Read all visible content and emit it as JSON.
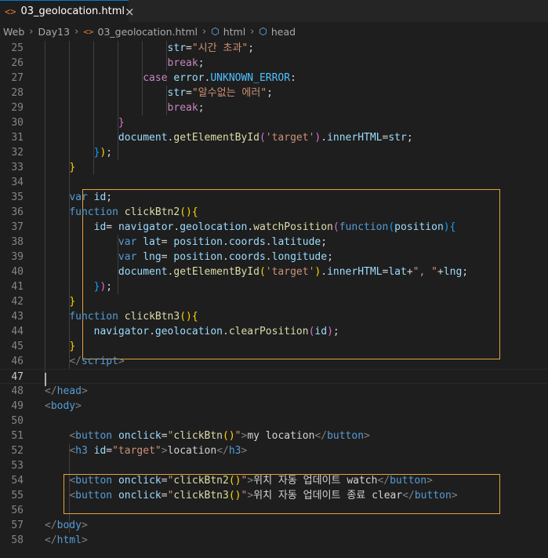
{
  "tab": {
    "icon": "<>",
    "filename": "03_geolocation.html",
    "close": "×"
  },
  "breadcrumb": {
    "items": [
      "Web",
      "Day13",
      "03_geolocation.html",
      "html",
      "head"
    ]
  },
  "lines": [
    {
      "n": "25",
      "segs": [
        {
          "t": "                    ",
          "c": "txt"
        },
        {
          "t": "str",
          "c": "var"
        },
        {
          "t": "=",
          "c": "txt"
        },
        {
          "t": "\"시간 초과\"",
          "c": "str"
        },
        {
          "t": ";",
          "c": "txt"
        }
      ]
    },
    {
      "n": "26",
      "segs": [
        {
          "t": "                    ",
          "c": "txt"
        },
        {
          "t": "break",
          "c": "ctl"
        },
        {
          "t": ";",
          "c": "txt"
        }
      ]
    },
    {
      "n": "27",
      "segs": [
        {
          "t": "                ",
          "c": "txt"
        },
        {
          "t": "case",
          "c": "ctl"
        },
        {
          "t": " ",
          "c": "txt"
        },
        {
          "t": "error",
          "c": "var"
        },
        {
          "t": ".",
          "c": "txt"
        },
        {
          "t": "UNKNOWN_ERROR",
          "c": "cst"
        },
        {
          "t": ":",
          "c": "txt"
        }
      ]
    },
    {
      "n": "28",
      "segs": [
        {
          "t": "                    ",
          "c": "txt"
        },
        {
          "t": "str",
          "c": "var"
        },
        {
          "t": "=",
          "c": "txt"
        },
        {
          "t": "\"알수없는 에러\"",
          "c": "str"
        },
        {
          "t": ";",
          "c": "txt"
        }
      ]
    },
    {
      "n": "29",
      "segs": [
        {
          "t": "                    ",
          "c": "txt"
        },
        {
          "t": "break",
          "c": "ctl"
        },
        {
          "t": ";",
          "c": "txt"
        }
      ]
    },
    {
      "n": "30",
      "segs": [
        {
          "t": "            ",
          "c": "txt"
        },
        {
          "t": "}",
          "c": "paren"
        }
      ]
    },
    {
      "n": "31",
      "segs": [
        {
          "t": "            ",
          "c": "txt"
        },
        {
          "t": "document",
          "c": "var"
        },
        {
          "t": ".",
          "c": "txt"
        },
        {
          "t": "getElementById",
          "c": "fn"
        },
        {
          "t": "(",
          "c": "paren"
        },
        {
          "t": "'target'",
          "c": "str"
        },
        {
          "t": ")",
          "c": "paren"
        },
        {
          "t": ".",
          "c": "txt"
        },
        {
          "t": "innerHTML",
          "c": "var"
        },
        {
          "t": "=",
          "c": "txt"
        },
        {
          "t": "str",
          "c": "var"
        },
        {
          "t": ";",
          "c": "txt"
        }
      ]
    },
    {
      "n": "32",
      "segs": [
        {
          "t": "        ",
          "c": "txt"
        },
        {
          "t": "}",
          "c": "paren2"
        },
        {
          "t": ")",
          "c": "paren3"
        },
        {
          "t": ";",
          "c": "txt"
        }
      ]
    },
    {
      "n": "33",
      "segs": [
        {
          "t": "    ",
          "c": "txt"
        },
        {
          "t": "}",
          "c": "paren3"
        }
      ]
    },
    {
      "n": "34",
      "segs": []
    },
    {
      "n": "35",
      "segs": [
        {
          "t": "    ",
          "c": "txt"
        },
        {
          "t": "var",
          "c": "kw"
        },
        {
          "t": " ",
          "c": "txt"
        },
        {
          "t": "id",
          "c": "var"
        },
        {
          "t": ";",
          "c": "txt"
        }
      ]
    },
    {
      "n": "36",
      "segs": [
        {
          "t": "    ",
          "c": "txt"
        },
        {
          "t": "function",
          "c": "kw"
        },
        {
          "t": " ",
          "c": "txt"
        },
        {
          "t": "clickBtn2",
          "c": "fn"
        },
        {
          "t": "()",
          "c": "paren3"
        },
        {
          "t": "{",
          "c": "paren3"
        }
      ]
    },
    {
      "n": "37",
      "segs": [
        {
          "t": "        ",
          "c": "txt"
        },
        {
          "t": "id",
          "c": "var"
        },
        {
          "t": "= ",
          "c": "txt"
        },
        {
          "t": "navigator",
          "c": "var"
        },
        {
          "t": ".",
          "c": "txt"
        },
        {
          "t": "geolocation",
          "c": "var"
        },
        {
          "t": ".",
          "c": "txt"
        },
        {
          "t": "watchPosition",
          "c": "fn"
        },
        {
          "t": "(",
          "c": "paren"
        },
        {
          "t": "function",
          "c": "kw"
        },
        {
          "t": "(",
          "c": "paren2"
        },
        {
          "t": "position",
          "c": "var"
        },
        {
          "t": ")",
          "c": "paren2"
        },
        {
          "t": "{",
          "c": "paren2"
        }
      ]
    },
    {
      "n": "38",
      "segs": [
        {
          "t": "            ",
          "c": "txt"
        },
        {
          "t": "var",
          "c": "kw"
        },
        {
          "t": " ",
          "c": "txt"
        },
        {
          "t": "lat",
          "c": "var"
        },
        {
          "t": "= ",
          "c": "txt"
        },
        {
          "t": "position",
          "c": "var"
        },
        {
          "t": ".",
          "c": "txt"
        },
        {
          "t": "coords",
          "c": "var"
        },
        {
          "t": ".",
          "c": "txt"
        },
        {
          "t": "latitude",
          "c": "var"
        },
        {
          "t": ";",
          "c": "txt"
        }
      ]
    },
    {
      "n": "39",
      "segs": [
        {
          "t": "            ",
          "c": "txt"
        },
        {
          "t": "var",
          "c": "kw"
        },
        {
          "t": " ",
          "c": "txt"
        },
        {
          "t": "lng",
          "c": "var"
        },
        {
          "t": "= ",
          "c": "txt"
        },
        {
          "t": "position",
          "c": "var"
        },
        {
          "t": ".",
          "c": "txt"
        },
        {
          "t": "coords",
          "c": "var"
        },
        {
          "t": ".",
          "c": "txt"
        },
        {
          "t": "longitude",
          "c": "var"
        },
        {
          "t": ";",
          "c": "txt"
        }
      ]
    },
    {
      "n": "40",
      "segs": [
        {
          "t": "            ",
          "c": "txt"
        },
        {
          "t": "document",
          "c": "var"
        },
        {
          "t": ".",
          "c": "txt"
        },
        {
          "t": "getElementById",
          "c": "fn"
        },
        {
          "t": "(",
          "c": "paren3"
        },
        {
          "t": "'target'",
          "c": "str"
        },
        {
          "t": ")",
          "c": "paren3"
        },
        {
          "t": ".",
          "c": "txt"
        },
        {
          "t": "innerHTML",
          "c": "var"
        },
        {
          "t": "=",
          "c": "txt"
        },
        {
          "t": "lat",
          "c": "var"
        },
        {
          "t": "+",
          "c": "txt"
        },
        {
          "t": "\", \"",
          "c": "str"
        },
        {
          "t": "+",
          "c": "txt"
        },
        {
          "t": "lng",
          "c": "var"
        },
        {
          "t": ";",
          "c": "txt"
        }
      ]
    },
    {
      "n": "41",
      "segs": [
        {
          "t": "        ",
          "c": "txt"
        },
        {
          "t": "}",
          "c": "paren2"
        },
        {
          "t": ")",
          "c": "paren"
        },
        {
          "t": ";",
          "c": "txt"
        }
      ]
    },
    {
      "n": "42",
      "segs": [
        {
          "t": "    ",
          "c": "txt"
        },
        {
          "t": "}",
          "c": "paren3"
        }
      ]
    },
    {
      "n": "43",
      "segs": [
        {
          "t": "    ",
          "c": "txt"
        },
        {
          "t": "function",
          "c": "kw"
        },
        {
          "t": " ",
          "c": "txt"
        },
        {
          "t": "clickBtn3",
          "c": "fn"
        },
        {
          "t": "()",
          "c": "paren3"
        },
        {
          "t": "{",
          "c": "paren3"
        }
      ]
    },
    {
      "n": "44",
      "segs": [
        {
          "t": "        ",
          "c": "txt"
        },
        {
          "t": "navigator",
          "c": "var"
        },
        {
          "t": ".",
          "c": "txt"
        },
        {
          "t": "geolocation",
          "c": "var"
        },
        {
          "t": ".",
          "c": "txt"
        },
        {
          "t": "clearPosition",
          "c": "fn"
        },
        {
          "t": "(",
          "c": "paren"
        },
        {
          "t": "id",
          "c": "var"
        },
        {
          "t": ")",
          "c": "paren"
        },
        {
          "t": ";",
          "c": "txt"
        }
      ]
    },
    {
      "n": "45",
      "segs": [
        {
          "t": "    ",
          "c": "txt"
        },
        {
          "t": "}",
          "c": "paren3"
        }
      ]
    },
    {
      "n": "46",
      "segs": [
        {
          "t": "    ",
          "c": "txt"
        },
        {
          "t": "</",
          "c": "br"
        },
        {
          "t": "script",
          "c": "tag"
        },
        {
          "t": ">",
          "c": "br"
        }
      ]
    },
    {
      "n": "47",
      "segs": []
    },
    {
      "n": "48",
      "segs": [
        {
          "t": "</",
          "c": "br"
        },
        {
          "t": "head",
          "c": "tag"
        },
        {
          "t": ">",
          "c": "br"
        }
      ]
    },
    {
      "n": "49",
      "segs": [
        {
          "t": "<",
          "c": "br"
        },
        {
          "t": "body",
          "c": "tag"
        },
        {
          "t": ">",
          "c": "br"
        }
      ]
    },
    {
      "n": "50",
      "segs": []
    },
    {
      "n": "51",
      "segs": [
        {
          "t": "    ",
          "c": "txt"
        },
        {
          "t": "<",
          "c": "br"
        },
        {
          "t": "button",
          "c": "tag"
        },
        {
          "t": " ",
          "c": "txt"
        },
        {
          "t": "onclick",
          "c": "attr"
        },
        {
          "t": "=",
          "c": "txt"
        },
        {
          "t": "\"",
          "c": "str"
        },
        {
          "t": "clickBtn",
          "c": "fn"
        },
        {
          "t": "()",
          "c": "paren3"
        },
        {
          "t": "\"",
          "c": "str"
        },
        {
          "t": ">",
          "c": "br"
        },
        {
          "t": "my location",
          "c": "txt"
        },
        {
          "t": "</",
          "c": "br"
        },
        {
          "t": "button",
          "c": "tag"
        },
        {
          "t": ">",
          "c": "br"
        }
      ]
    },
    {
      "n": "52",
      "segs": [
        {
          "t": "    ",
          "c": "txt"
        },
        {
          "t": "<",
          "c": "br"
        },
        {
          "t": "h3",
          "c": "tag"
        },
        {
          "t": " ",
          "c": "txt"
        },
        {
          "t": "id",
          "c": "attr"
        },
        {
          "t": "=",
          "c": "txt"
        },
        {
          "t": "\"target\"",
          "c": "str"
        },
        {
          "t": ">",
          "c": "br"
        },
        {
          "t": "location",
          "c": "txt"
        },
        {
          "t": "</",
          "c": "br"
        },
        {
          "t": "h3",
          "c": "tag"
        },
        {
          "t": ">",
          "c": "br"
        }
      ]
    },
    {
      "n": "53",
      "segs": []
    },
    {
      "n": "54",
      "segs": [
        {
          "t": "    ",
          "c": "txt"
        },
        {
          "t": "<",
          "c": "br"
        },
        {
          "t": "button",
          "c": "tag"
        },
        {
          "t": " ",
          "c": "txt"
        },
        {
          "t": "onclick",
          "c": "attr"
        },
        {
          "t": "=",
          "c": "txt"
        },
        {
          "t": "\"",
          "c": "str"
        },
        {
          "t": "clickBtn2",
          "c": "fn"
        },
        {
          "t": "()",
          "c": "paren3"
        },
        {
          "t": "\"",
          "c": "str"
        },
        {
          "t": ">",
          "c": "br"
        },
        {
          "t": "위치 자동 업데이트 watch",
          "c": "txt"
        },
        {
          "t": "</",
          "c": "br"
        },
        {
          "t": "button",
          "c": "tag"
        },
        {
          "t": ">",
          "c": "br"
        }
      ]
    },
    {
      "n": "55",
      "segs": [
        {
          "t": "    ",
          "c": "txt"
        },
        {
          "t": "<",
          "c": "br"
        },
        {
          "t": "button",
          "c": "tag"
        },
        {
          "t": " ",
          "c": "txt"
        },
        {
          "t": "onclick",
          "c": "attr"
        },
        {
          "t": "=",
          "c": "txt"
        },
        {
          "t": "\"",
          "c": "str"
        },
        {
          "t": "clickBtn3",
          "c": "fn"
        },
        {
          "t": "()",
          "c": "paren3"
        },
        {
          "t": "\"",
          "c": "str"
        },
        {
          "t": ">",
          "c": "br"
        },
        {
          "t": "위치 자동 업데이트 종료 clear",
          "c": "txt"
        },
        {
          "t": "</",
          "c": "br"
        },
        {
          "t": "button",
          "c": "tag"
        },
        {
          "t": ">",
          "c": "br"
        }
      ]
    },
    {
      "n": "56",
      "segs": []
    },
    {
      "n": "57",
      "segs": [
        {
          "t": "</",
          "c": "br"
        },
        {
          "t": "body",
          "c": "tag"
        },
        {
          "t": ">",
          "c": "br"
        }
      ]
    },
    {
      "n": "58",
      "segs": [
        {
          "t": "</",
          "c": "br"
        },
        {
          "t": "html",
          "c": "tag"
        },
        {
          "t": ">",
          "c": "br"
        }
      ]
    }
  ]
}
